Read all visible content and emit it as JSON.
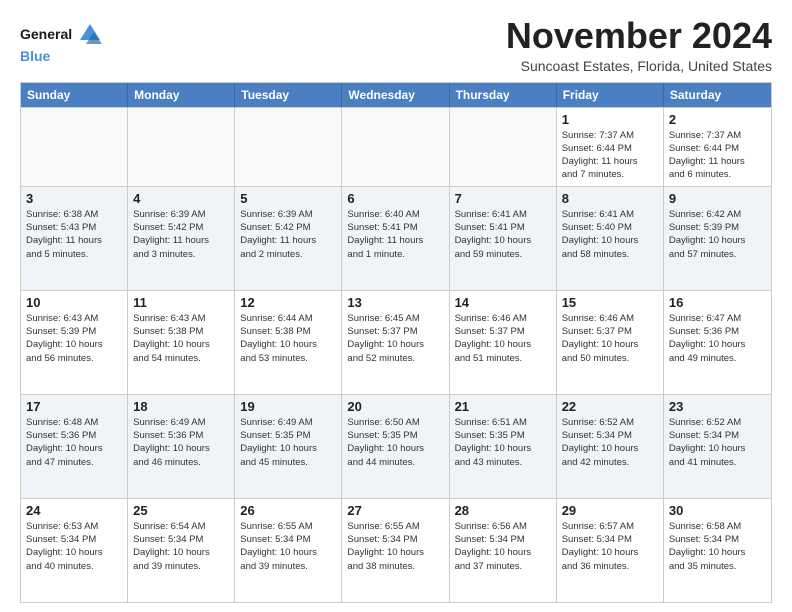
{
  "logo": {
    "line1": "General",
    "line2": "Blue"
  },
  "title": "November 2024",
  "location": "Suncoast Estates, Florida, United States",
  "weekdays": [
    "Sunday",
    "Monday",
    "Tuesday",
    "Wednesday",
    "Thursday",
    "Friday",
    "Saturday"
  ],
  "rows": [
    [
      {
        "day": "",
        "info": ""
      },
      {
        "day": "",
        "info": ""
      },
      {
        "day": "",
        "info": ""
      },
      {
        "day": "",
        "info": ""
      },
      {
        "day": "",
        "info": ""
      },
      {
        "day": "1",
        "info": "Sunrise: 7:37 AM\nSunset: 6:44 PM\nDaylight: 11 hours\nand 7 minutes."
      },
      {
        "day": "2",
        "info": "Sunrise: 7:37 AM\nSunset: 6:44 PM\nDaylight: 11 hours\nand 6 minutes."
      }
    ],
    [
      {
        "day": "3",
        "info": "Sunrise: 6:38 AM\nSunset: 5:43 PM\nDaylight: 11 hours\nand 5 minutes."
      },
      {
        "day": "4",
        "info": "Sunrise: 6:39 AM\nSunset: 5:42 PM\nDaylight: 11 hours\nand 3 minutes."
      },
      {
        "day": "5",
        "info": "Sunrise: 6:39 AM\nSunset: 5:42 PM\nDaylight: 11 hours\nand 2 minutes."
      },
      {
        "day": "6",
        "info": "Sunrise: 6:40 AM\nSunset: 5:41 PM\nDaylight: 11 hours\nand 1 minute."
      },
      {
        "day": "7",
        "info": "Sunrise: 6:41 AM\nSunset: 5:41 PM\nDaylight: 10 hours\nand 59 minutes."
      },
      {
        "day": "8",
        "info": "Sunrise: 6:41 AM\nSunset: 5:40 PM\nDaylight: 10 hours\nand 58 minutes."
      },
      {
        "day": "9",
        "info": "Sunrise: 6:42 AM\nSunset: 5:39 PM\nDaylight: 10 hours\nand 57 minutes."
      }
    ],
    [
      {
        "day": "10",
        "info": "Sunrise: 6:43 AM\nSunset: 5:39 PM\nDaylight: 10 hours\nand 56 minutes."
      },
      {
        "day": "11",
        "info": "Sunrise: 6:43 AM\nSunset: 5:38 PM\nDaylight: 10 hours\nand 54 minutes."
      },
      {
        "day": "12",
        "info": "Sunrise: 6:44 AM\nSunset: 5:38 PM\nDaylight: 10 hours\nand 53 minutes."
      },
      {
        "day": "13",
        "info": "Sunrise: 6:45 AM\nSunset: 5:37 PM\nDaylight: 10 hours\nand 52 minutes."
      },
      {
        "day": "14",
        "info": "Sunrise: 6:46 AM\nSunset: 5:37 PM\nDaylight: 10 hours\nand 51 minutes."
      },
      {
        "day": "15",
        "info": "Sunrise: 6:46 AM\nSunset: 5:37 PM\nDaylight: 10 hours\nand 50 minutes."
      },
      {
        "day": "16",
        "info": "Sunrise: 6:47 AM\nSunset: 5:36 PM\nDaylight: 10 hours\nand 49 minutes."
      }
    ],
    [
      {
        "day": "17",
        "info": "Sunrise: 6:48 AM\nSunset: 5:36 PM\nDaylight: 10 hours\nand 47 minutes."
      },
      {
        "day": "18",
        "info": "Sunrise: 6:49 AM\nSunset: 5:36 PM\nDaylight: 10 hours\nand 46 minutes."
      },
      {
        "day": "19",
        "info": "Sunrise: 6:49 AM\nSunset: 5:35 PM\nDaylight: 10 hours\nand 45 minutes."
      },
      {
        "day": "20",
        "info": "Sunrise: 6:50 AM\nSunset: 5:35 PM\nDaylight: 10 hours\nand 44 minutes."
      },
      {
        "day": "21",
        "info": "Sunrise: 6:51 AM\nSunset: 5:35 PM\nDaylight: 10 hours\nand 43 minutes."
      },
      {
        "day": "22",
        "info": "Sunrise: 6:52 AM\nSunset: 5:34 PM\nDaylight: 10 hours\nand 42 minutes."
      },
      {
        "day": "23",
        "info": "Sunrise: 6:52 AM\nSunset: 5:34 PM\nDaylight: 10 hours\nand 41 minutes."
      }
    ],
    [
      {
        "day": "24",
        "info": "Sunrise: 6:53 AM\nSunset: 5:34 PM\nDaylight: 10 hours\nand 40 minutes."
      },
      {
        "day": "25",
        "info": "Sunrise: 6:54 AM\nSunset: 5:34 PM\nDaylight: 10 hours\nand 39 minutes."
      },
      {
        "day": "26",
        "info": "Sunrise: 6:55 AM\nSunset: 5:34 PM\nDaylight: 10 hours\nand 39 minutes."
      },
      {
        "day": "27",
        "info": "Sunrise: 6:55 AM\nSunset: 5:34 PM\nDaylight: 10 hours\nand 38 minutes."
      },
      {
        "day": "28",
        "info": "Sunrise: 6:56 AM\nSunset: 5:34 PM\nDaylight: 10 hours\nand 37 minutes."
      },
      {
        "day": "29",
        "info": "Sunrise: 6:57 AM\nSunset: 5:34 PM\nDaylight: 10 hours\nand 36 minutes."
      },
      {
        "day": "30",
        "info": "Sunrise: 6:58 AM\nSunset: 5:34 PM\nDaylight: 10 hours\nand 35 minutes."
      }
    ]
  ]
}
